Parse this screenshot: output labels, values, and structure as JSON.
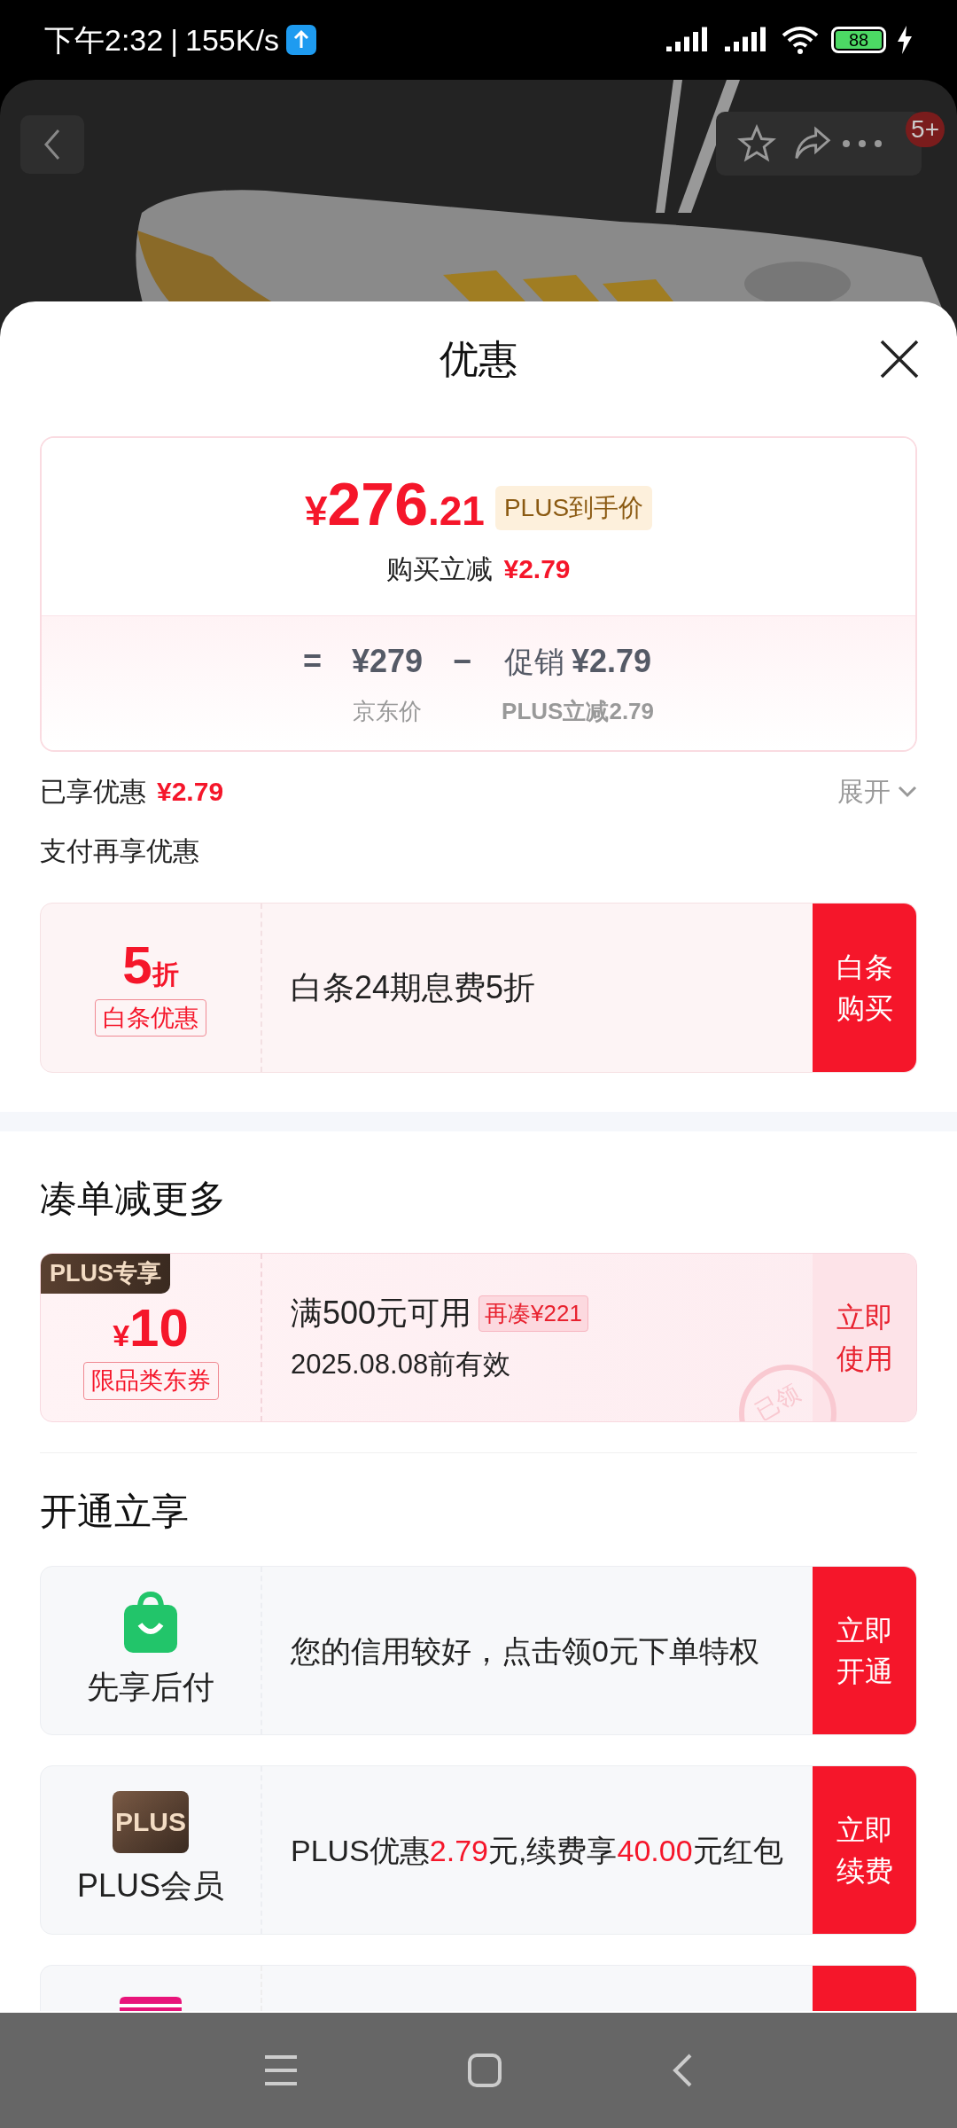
{
  "status_bar": {
    "time": "下午2:32",
    "separator": "|",
    "speed": "155K/s",
    "battery": "88"
  },
  "header": {
    "badge": "5+"
  },
  "sheet": {
    "title": "优惠"
  },
  "price_card": {
    "currency": "¥",
    "integer": "276",
    "decimal": ".21",
    "tag": "PLUS到手价",
    "reduce_label": "购买立减",
    "reduce_value": "¥2.79",
    "equals": "=",
    "base_price": "¥279",
    "minus": "−",
    "promo_label": "促销",
    "promo_value": "¥2.79",
    "base_caption": "京东价",
    "promo_caption": "PLUS立减2.79"
  },
  "enjoyed": {
    "label": "已享优惠",
    "value": "¥2.79",
    "expand": "展开",
    "expanded": false
  },
  "pay_section": {
    "title": "支付再享优惠"
  },
  "baitiao": {
    "big": "5",
    "unit": "折",
    "tag": "白条优惠",
    "desc": "白条24期息费5折",
    "button": "白条购买"
  },
  "bundle_section": {
    "title": "凑单减更多"
  },
  "coupon": {
    "badge": "PLUS专享",
    "currency": "¥",
    "amount": "10",
    "tag": "限品类东券",
    "condition": "满500元可用",
    "extra": "再凑¥221",
    "expiry": "2025.08.08前有效",
    "button": "立即使用",
    "stamp": "已领",
    "claimed": true
  },
  "open_section": {
    "title": "开通立享"
  },
  "offers": [
    {
      "kind": "credit",
      "name": "先享后付",
      "desc_parts": [
        {
          "text": "您的信用较好，点击领0元下单特权",
          "highlight": false
        }
      ],
      "button": "立即开通"
    },
    {
      "kind": "plus",
      "icon_text": "PLUS",
      "name": "PLUS会员",
      "desc_parts": [
        {
          "text": "PLUS优惠",
          "highlight": false
        },
        {
          "text": "2.79",
          "highlight": true
        },
        {
          "text": "元,续费享",
          "highlight": false
        },
        {
          "text": "40.00",
          "highlight": true
        },
        {
          "text": "元红包",
          "highlight": false
        }
      ],
      "button": "立即续费"
    },
    {
      "kind": "card"
    }
  ]
}
